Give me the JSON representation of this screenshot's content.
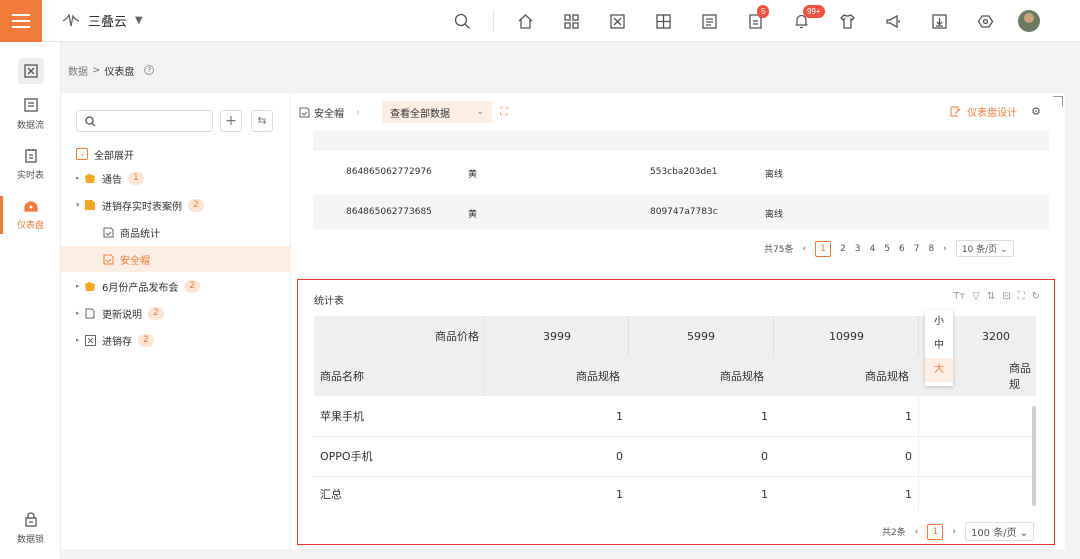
{
  "app": {
    "name": "三叠云",
    "accent": "#f27a3a"
  },
  "topbar": {
    "badge_doc": "5",
    "badge_bell": "99+"
  },
  "leftnav": [
    {
      "label": "",
      "icon": "dashboard-grid-icon"
    },
    {
      "label": "数据流",
      "icon": "dataflow-icon"
    },
    {
      "label": "实时表",
      "icon": "realtime-table-icon"
    },
    {
      "label": "仪表盘",
      "icon": "dashboard-icon",
      "active": true
    },
    {
      "label": "数据锁",
      "icon": "lock-icon"
    }
  ],
  "breadcrumb": {
    "parent": "数据",
    "sep": ">",
    "current": "仪表盘"
  },
  "tree": {
    "expand_all": "全部展开",
    "items": [
      {
        "label": "通告",
        "count": "1"
      },
      {
        "label": "进销存实时表案例",
        "count": "2"
      },
      {
        "label": "商品统计",
        "count": ""
      },
      {
        "label": "安全帽",
        "count": ""
      },
      {
        "label": "6月份产品发布会",
        "count": "2"
      },
      {
        "label": "更新说明",
        "count": "2"
      },
      {
        "label": "进销存",
        "count": "2"
      }
    ]
  },
  "tabs": {
    "current": "安全帽",
    "view": "查看全部数据",
    "design": "仪表盘设计"
  },
  "data_table": {
    "rows": [
      {
        "id": "864865062772976",
        "color": "黄",
        "code": "553cba203de1",
        "status": "离线"
      },
      {
        "id": "864865062773685",
        "color": "黄",
        "code": "809747a7783c",
        "status": "离线"
      }
    ],
    "pager": {
      "total": "共75条",
      "pages": [
        "1",
        "2",
        "3",
        "4",
        "5",
        "6",
        "7",
        "8"
      ],
      "size": "10 条/页"
    }
  },
  "stats": {
    "title": "统计表",
    "price_label": "商品价格",
    "prices": [
      "3999",
      "5999",
      "10999",
      "3200"
    ],
    "name_header": "商品名称",
    "spec_header": "商品规格",
    "rows": [
      {
        "name": "苹果手机",
        "vals": [
          "1",
          "1",
          "1",
          ""
        ]
      },
      {
        "name": "OPPO手机",
        "vals": [
          "0",
          "0",
          "0",
          ""
        ]
      },
      {
        "name": "汇总",
        "vals": [
          "1",
          "1",
          "1",
          ""
        ]
      }
    ],
    "spec_partial": "商品规",
    "size_options": [
      "小",
      "中",
      "大"
    ],
    "pager": {
      "total": "共2条",
      "page": "1",
      "size": "100 条/页"
    }
  }
}
